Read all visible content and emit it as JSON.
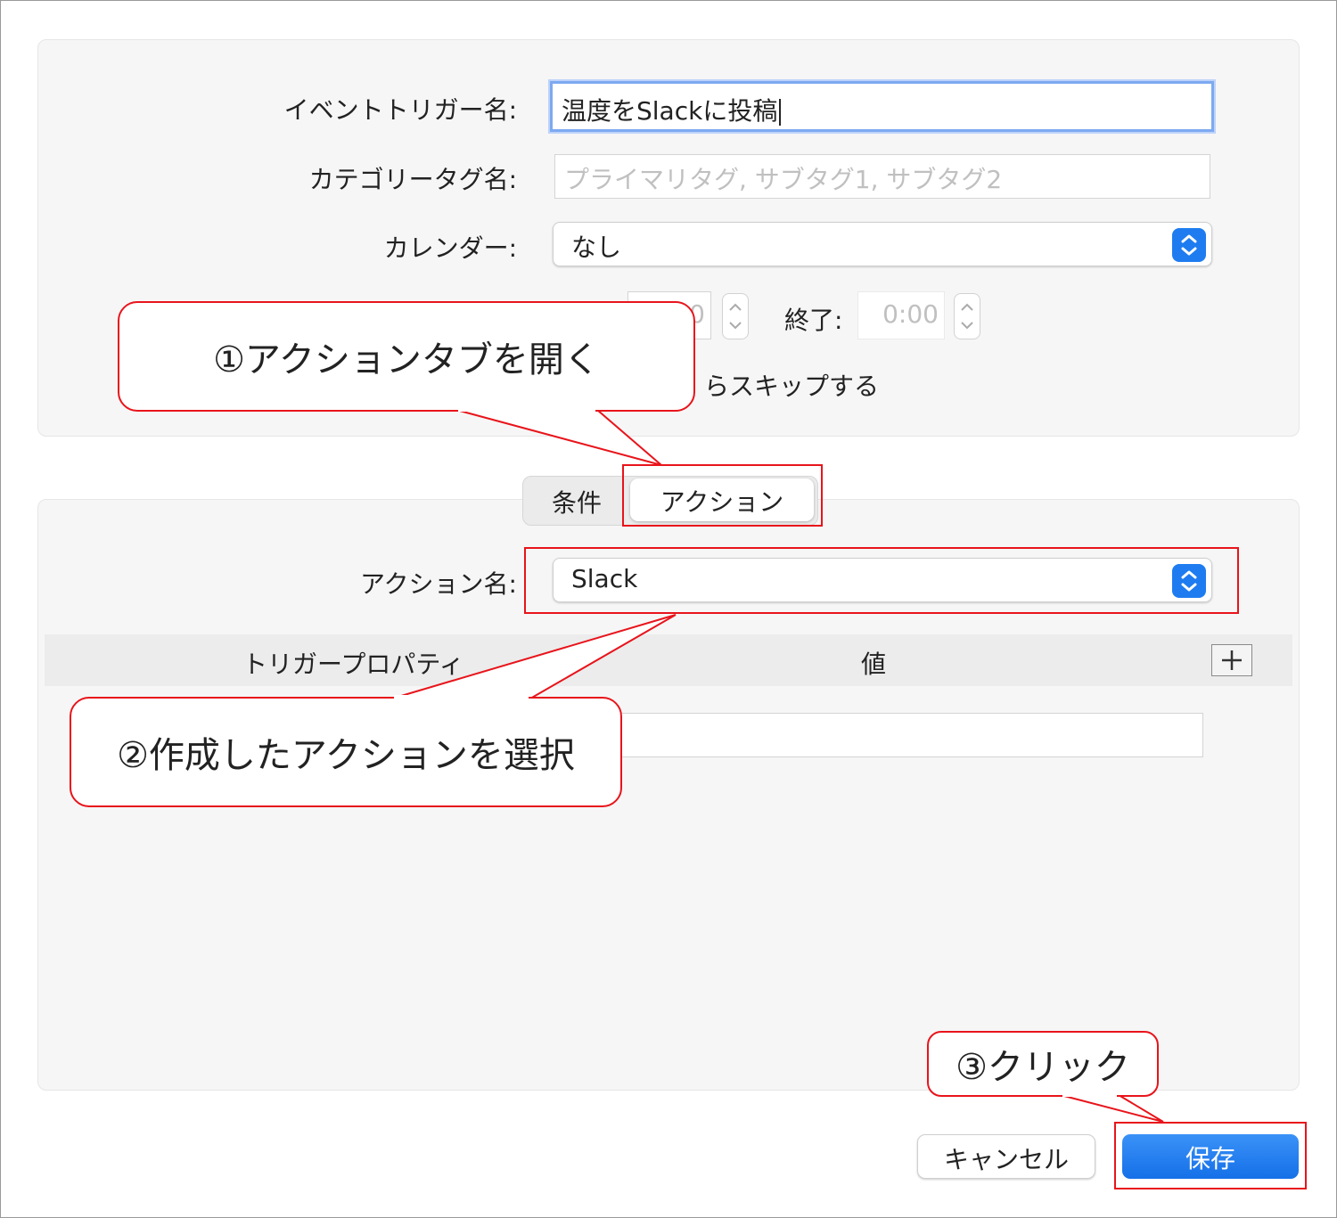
{
  "form": {
    "event_trigger_name_label": "イベントトリガー名:",
    "event_trigger_name_value": "温度をSlackに投稿",
    "category_tag_label": "カテゴリータグ名:",
    "category_tag_placeholder": "プライマリタグ, サブタグ1, サブタグ2",
    "calendar_label": "カレンダー:",
    "calendar_value": "なし",
    "start_time_partial": "0",
    "end_label": "終了:",
    "end_time_value": "0:00",
    "skip_partial": "らスキップする"
  },
  "tabs": [
    {
      "label": "条件",
      "selected": false
    },
    {
      "label": "アクション",
      "selected": true
    }
  ],
  "action": {
    "action_name_label": "アクション名:",
    "action_name_value": "Slack",
    "col_property": "トリガープロパティ",
    "col_value": "値",
    "add_icon": "plus-icon"
  },
  "buttons": {
    "cancel": "キャンセル",
    "save": "保存"
  },
  "callouts": {
    "c1": "①アクションタブを開く",
    "c2": "②作成したアクションを選択",
    "c3": "③クリック"
  },
  "colors": {
    "accent": "#1f7cf0",
    "annotation_red": "#e8141b",
    "focus_ring": "#7da9f0"
  }
}
